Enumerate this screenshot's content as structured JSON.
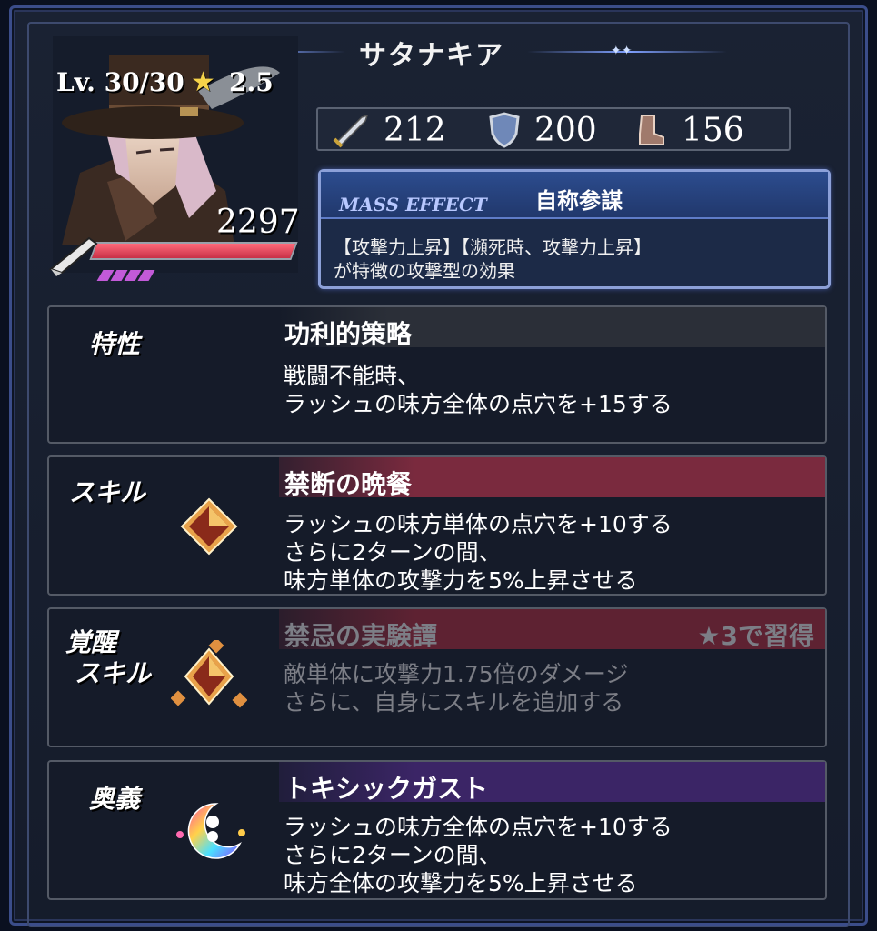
{
  "character": {
    "name": "サタナキア",
    "level_label": "Lv. 30/30",
    "rarity": "2.5",
    "hp": "2297"
  },
  "stats": {
    "attack": "212",
    "defense": "200",
    "speed": "156"
  },
  "mass_effect": {
    "tag": "MASS EFFECT",
    "name": "自称参謀",
    "desc_line1": "【攻撃力上昇】【瀕死時、攻撃力上昇】",
    "desc_line2": "が特徴の攻撃型の効果"
  },
  "trait": {
    "label": "特性",
    "title": "功利的策略",
    "desc_line1": "戦闘不能時、",
    "desc_line2": "ラッシュの味方全体の点穴を+15する"
  },
  "skill": {
    "label": "スキル",
    "title": "禁断の晩餐",
    "desc_line1": "ラッシュの味方単体の点穴を+10する",
    "desc_line2": "さらに2ターンの間、",
    "desc_line3": "味方単体の攻撃力を5%上昇させる"
  },
  "awakened_skill": {
    "label_line1": "覚醒",
    "label_line2": "スキル",
    "title": "禁忌の実験譚",
    "note": "★3で習得",
    "desc_line1": "敵単体に攻撃力1.75倍のダメージ",
    "desc_line2": "さらに、自身にスキルを追加する"
  },
  "ultimate": {
    "label": "奥義",
    "title": "トキシックガスト",
    "desc_line1": "ラッシュの味方全体の点穴を+10する",
    "desc_line2": "さらに2ターンの間、",
    "desc_line3": "味方全体の攻撃力を5%上昇させる"
  },
  "colors": {
    "skill_header": "#7a2a3e",
    "awakened_header": "#5e2232",
    "ultimate_header": "#3b2566",
    "trait_header": "#2b2f38"
  }
}
